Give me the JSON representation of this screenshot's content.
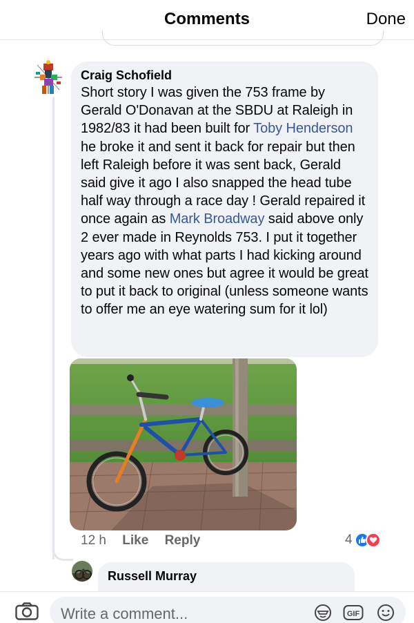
{
  "header": {
    "title": "Comments",
    "done_label": "Done"
  },
  "comment": {
    "author": "Craig Schofield",
    "text_1": "Short story I was given the 753 frame by Gerald O'Donavan at the SBDU at Raleigh in 1982/83 it had been built for ",
    "mention_1": "Toby Henderson",
    "text_2": " he broke it and sent it back for repair but then left Raleigh before it was sent back, Gerald said give it ago I also snapped the head tube half way through a race day ! Gerald repaired it once again as ",
    "mention_2": "Mark Broadway",
    "text_3": " said above only 2 ever made in Reynolds 753. I put it together years ago with what parts I had kicking around and some new ones but agree it would be great to put it back to original (unless someone wants to offer me an eye watering sum for it lol)",
    "time": "12 h",
    "like_label": "Like",
    "reply_label": "Reply",
    "reaction_count": "4"
  },
  "reply": {
    "author": "Russell Murray"
  },
  "composer": {
    "placeholder": "Write a comment...",
    "gif_label": "GIF"
  },
  "icons": {
    "camera": "camera-icon",
    "sticker": "sticker-icon",
    "gif": "gif-icon",
    "emoji": "emoji-icon",
    "like_reaction": "like-reaction-icon",
    "love_reaction": "love-reaction-icon"
  },
  "colors": {
    "mention": "#385898",
    "bubble": "#f0f2f5",
    "like": "#1877f2",
    "love": "#f33e58"
  }
}
